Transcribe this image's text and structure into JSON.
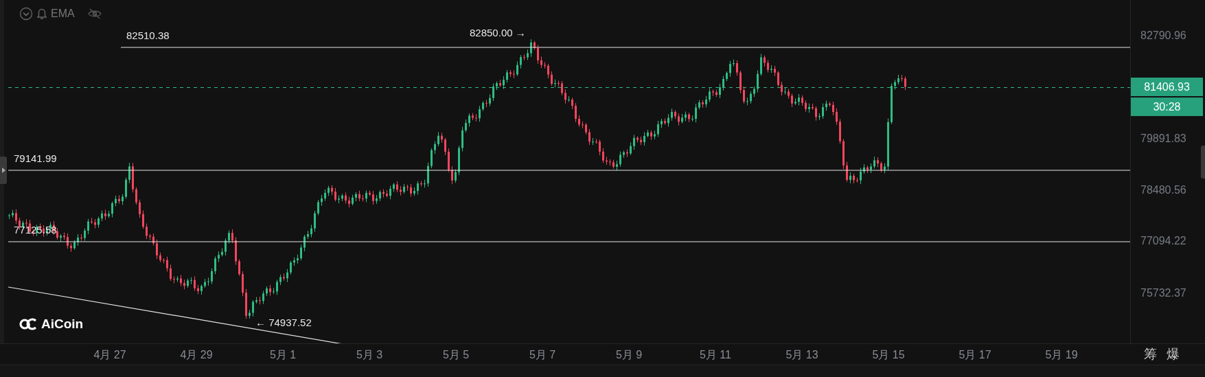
{
  "indicator_bar": {
    "label": "EMA"
  },
  "level_lines": [
    {
      "label": "82510.38"
    },
    {
      "label": "79141.99"
    },
    {
      "label": "77125.58"
    }
  ],
  "extremes": [
    {
      "kind": "high",
      "label": "82850.00 →"
    },
    {
      "kind": "low",
      "label": "← 74937.52"
    }
  ],
  "price_axis": {
    "ticks": [
      "82790.96",
      "79891.83",
      "78480.56",
      "77094.22",
      "75732.37"
    ],
    "last_price": "81406.93",
    "countdown": "30:28"
  },
  "time_axis": {
    "ticks": [
      "4月 27",
      "4月 29",
      "5月 1",
      "5月 3",
      "5月 5",
      "5月 7",
      "5月 9",
      "5月 11",
      "5月 13",
      "5月 15",
      "5月 17",
      "5月 19"
    ]
  },
  "corner_buttons": [
    "筹",
    "爆"
  ],
  "watermark_logo": {
    "text": "AiCoin"
  }
}
